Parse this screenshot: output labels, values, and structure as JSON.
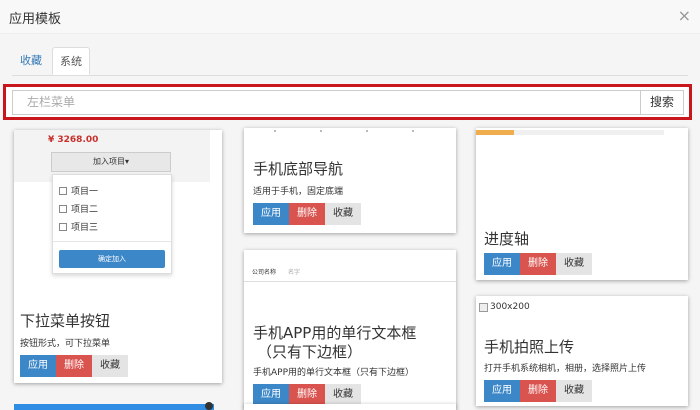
{
  "modal": {
    "title": "应用模板",
    "close": "×"
  },
  "tabs": [
    {
      "label": "收藏"
    },
    {
      "label": "系统"
    }
  ],
  "search": {
    "value": "左栏菜单",
    "button": "搜索"
  },
  "buttons": {
    "apply": "应用",
    "delete": "删除",
    "favorite": "收藏"
  },
  "cards": [
    {
      "title": "下拉菜单按钮",
      "desc": "按钮形式，可下拉菜单",
      "preview": {
        "price": "¥ 3268.00",
        "dropdown": "加入项目▾",
        "items": [
          "项目一",
          "项目二",
          "项目三"
        ],
        "confirm": "确定加入"
      }
    },
    {
      "title": "手机底部导航",
      "desc": "适用于手机，固定底端"
    },
    {
      "title": "进度轴",
      "desc": "",
      "preview": {
        "progress": 0.2
      }
    },
    {
      "title": "",
      "desc": ""
    },
    {
      "title_line1": "手机APP用的单行文本框",
      "title_line2": "（只有下边框）",
      "desc": "手机APP用的单行文本框（只有下边框）",
      "preview": {
        "label": "公司名称",
        "placeholder": "名字"
      }
    },
    {
      "title": "手机拍照上传",
      "desc": "打开手机系统相机，相册，选择照片上传",
      "preview": {
        "img_alt": "300x200"
      }
    }
  ],
  "colors": {
    "accent": "#3c87c8",
    "danger": "#d9534f",
    "highlight": "#c9161c"
  }
}
